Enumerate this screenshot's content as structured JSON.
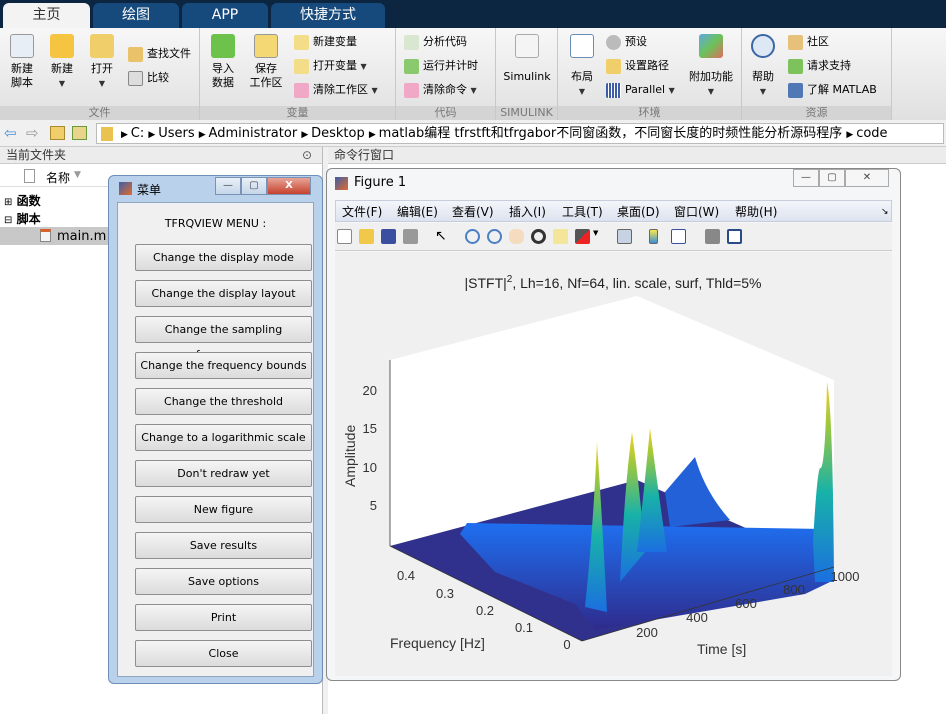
{
  "tabs": [
    {
      "label": "主页"
    },
    {
      "label": "绘图"
    },
    {
      "label": "APP"
    },
    {
      "label": "快捷方式"
    }
  ],
  "toolstrip": {
    "file": {
      "label": "文件",
      "new_script": "新建\n脚本",
      "new": "新建",
      "open": "打开",
      "find_files": "查找文件",
      "compare": "比较"
    },
    "variable": {
      "label": "变量",
      "import": "导入\n数据",
      "save_ws": "保存\n工作区",
      "new_var": "新建变量",
      "open_var": "打开变量",
      "clear_ws": "清除工作区"
    },
    "code": {
      "label": "代码",
      "analyze": "分析代码",
      "run_time": "运行并计时",
      "clear_cmd": "清除命令"
    },
    "simulink": {
      "label": "SIMULINK",
      "btn": "Simulink"
    },
    "env": {
      "label": "环境",
      "layout": "布局",
      "prefs": "预设",
      "set_path": "设置路径",
      "parallel": "Parallel",
      "addons": "附加功能"
    },
    "resources": {
      "label": "资源",
      "help": "帮助",
      "community": "社区",
      "support": "请求支持",
      "learn": "了解 MATLAB"
    }
  },
  "address": {
    "path": [
      "C:",
      "Users",
      "Administrator",
      "Desktop",
      "matlab编程 tfrstft和tfrgabor不同窗函数，不同窗长度的时频性能分析源码程序",
      "code"
    ]
  },
  "current_folder": {
    "title": "当前文件夹",
    "col_name": "名称",
    "items": [
      {
        "label": "函数",
        "type": "folder",
        "expanded": false
      },
      {
        "label": "脚本",
        "type": "folder",
        "expanded": true
      },
      {
        "label": "main.m",
        "type": "file",
        "selected": true
      }
    ]
  },
  "command_window": {
    "title": "命令行窗口"
  },
  "menu_window": {
    "title": "菜单",
    "heading": "TFRQVIEW MENU :",
    "buttons": [
      "Change the display mode",
      "Change the display layout",
      "Change the sampling frequency",
      "Change the frequency bounds",
      "Change the threshold",
      "Change to a logarithmic scale",
      "Don't redraw yet",
      "New figure",
      "Save results",
      "Save options",
      "Print",
      "Close"
    ]
  },
  "figure_window": {
    "title": "Figure 1",
    "menu": [
      "文件(F)",
      "编辑(E)",
      "查看(V)",
      "插入(I)",
      "工具(T)",
      "桌面(D)",
      "窗口(W)",
      "帮助(H)"
    ],
    "plot": {
      "title_main": "|STFT|",
      "title_sup": "2",
      "title_rest": ", Lh=16, Nf=64, lin. scale, surf, Thld=5%",
      "zlabel": "Amplitude",
      "xlabel": "Frequency [Hz]",
      "ylabel": "Time [s]",
      "z_ticks": [
        "20",
        "15",
        "10",
        "5"
      ],
      "f_ticks": [
        "0.4",
        "0.3",
        "0.2",
        "0.1",
        "0"
      ],
      "t_ticks": [
        "200",
        "400",
        "600",
        "800",
        "1000"
      ],
      "colormap": "parula"
    }
  }
}
